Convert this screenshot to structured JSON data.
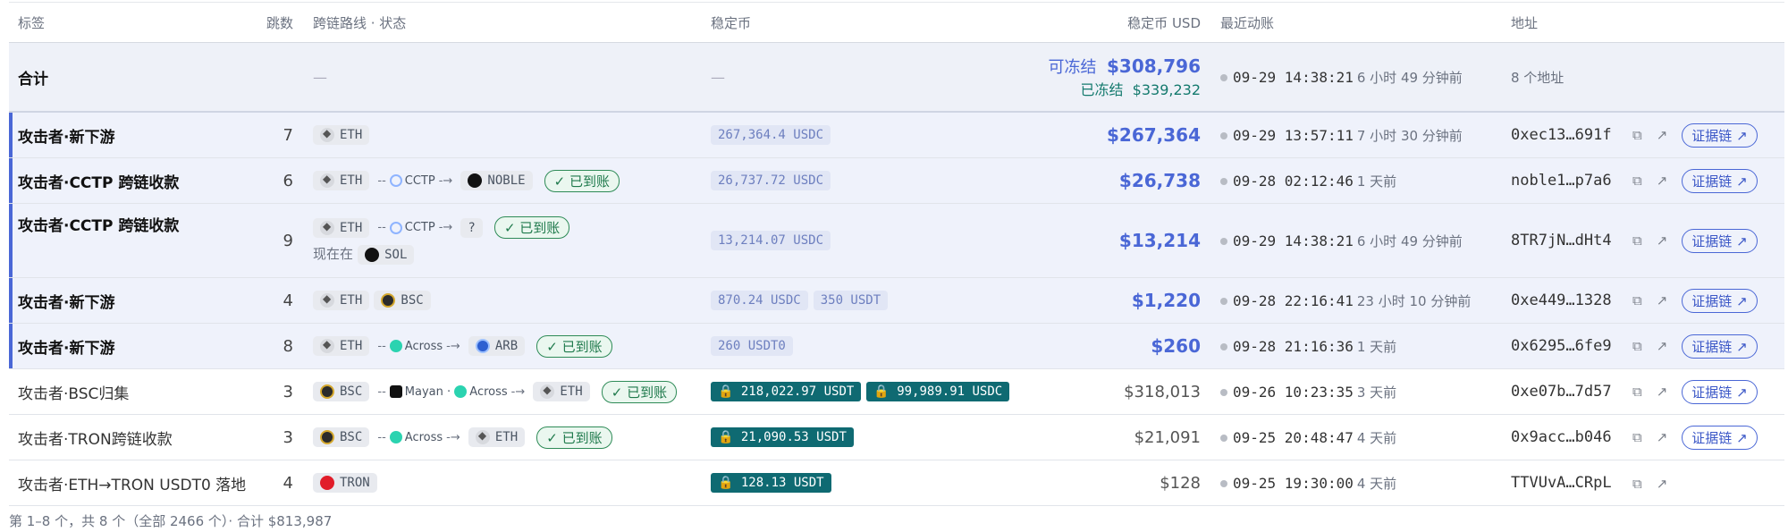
{
  "headers": {
    "label": "标签",
    "hops": "跳数",
    "route": "跨链路线 · 状态",
    "stable": "稳定币",
    "usd": "稳定币 USD",
    "last": "最近动账",
    "addr": "地址"
  },
  "total": {
    "label": "合计",
    "route": "—",
    "stable": "—",
    "freezable": "可冻结",
    "freezable_amount": "$308,796",
    "frozen": "已冻结",
    "frozen_amount": "$339,232",
    "time": "09-29 14:38:21",
    "ago": "6 小时 49 分钟前",
    "addr": "8 个地址"
  },
  "rows": [
    {
      "label": "攻击者·新下游",
      "hops": "7",
      "chain1": "ETH",
      "amt1": "267,364.4 USDC",
      "usd": "$267,364",
      "time": "09-29 13:57:11",
      "ago": "7 小时 30 分钟前",
      "addr": "0xec13…691f",
      "evid": "证据链 ↗"
    },
    {
      "label": "攻击者·CCTP 跨链收款",
      "hops": "6",
      "chain1": "ETH",
      "bridge": "CCTP",
      "chain2": "NOBLE",
      "status": "已到账",
      "amt1": "26,737.72 USDC",
      "usd": "$26,738",
      "time": "09-28 02:12:46",
      "ago": "1 天前",
      "addr": "noble1…p7a6",
      "evid": "证据链 ↗"
    },
    {
      "label": "攻击者·CCTP 跨链收款",
      "hops": "9",
      "chain1": "ETH",
      "bridge": "CCTP",
      "chain2": "?",
      "status": "已到账",
      "now": "现在在",
      "now_chain": "SOL",
      "amt1": "13,214.07 USDC",
      "usd": "$13,214",
      "time": "09-29 14:38:21",
      "ago": "6 小时 49 分钟前",
      "addr": "8TR7jN…dHt4",
      "evid": "证据链 ↗"
    },
    {
      "label": "攻击者·新下游",
      "hops": "4",
      "chain1": "ETH",
      "chain2": "BSC",
      "amt1": "870.24 USDC",
      "amt2": "350 USDT",
      "usd": "$1,220",
      "time": "09-28 22:16:41",
      "ago": "23 小时 10 分钟前",
      "addr": "0xe449…1328",
      "evid": "证据链 ↗"
    },
    {
      "label": "攻击者·新下游",
      "hops": "8",
      "chain1": "ETH",
      "bridge": "Across",
      "chain2": "ARB",
      "status": "已到账",
      "amt1": "260 USDT0",
      "usd": "$260",
      "time": "09-28 21:16:36",
      "ago": "1 天前",
      "addr": "0x6295…6fe9",
      "evid": "证据链 ↗"
    },
    {
      "label": "攻击者·BSC归集",
      "hops": "3",
      "chain1": "BSC",
      "bridge": "Mayan",
      "bridge2": "Across",
      "chain2": "ETH",
      "status": "已到账",
      "frozen1": "218,022.97 USDT",
      "frozen2": "99,989.91 USDC",
      "usd": "$318,013",
      "time": "09-26 10:23:35",
      "ago": "3 天前",
      "addr": "0xe07b…7d57",
      "evid": "证据链 ↗"
    },
    {
      "label": "攻击者·TRON跨链收款",
      "hops": "3",
      "chain1": "BSC",
      "bridge": "Across",
      "chain2": "ETH",
      "status": "已到账",
      "frozen1": "21,090.53 USDT",
      "usd": "$21,091",
      "time": "09-25 20:48:47",
      "ago": "4 天前",
      "addr": "0x9acc…b046",
      "evid": "证据链 ↗"
    },
    {
      "label": "攻击者·ETH→TRON USDT0 落地",
      "hops": "4",
      "chain1": "TRON",
      "frozen1": "128.13 USDT",
      "usd": "$128",
      "time": "09-25 19:30:00",
      "ago": "4 天前",
      "addr": "TTVUvA…CRpL"
    }
  ],
  "footer": "第 1–8 个，共 8 个（全部 2466 个）· 合计 $813,987",
  "colors": {
    "accent": "#4a67d6",
    "frozen_bg": "#0f6a72",
    "ok": "#1f7a4c"
  }
}
